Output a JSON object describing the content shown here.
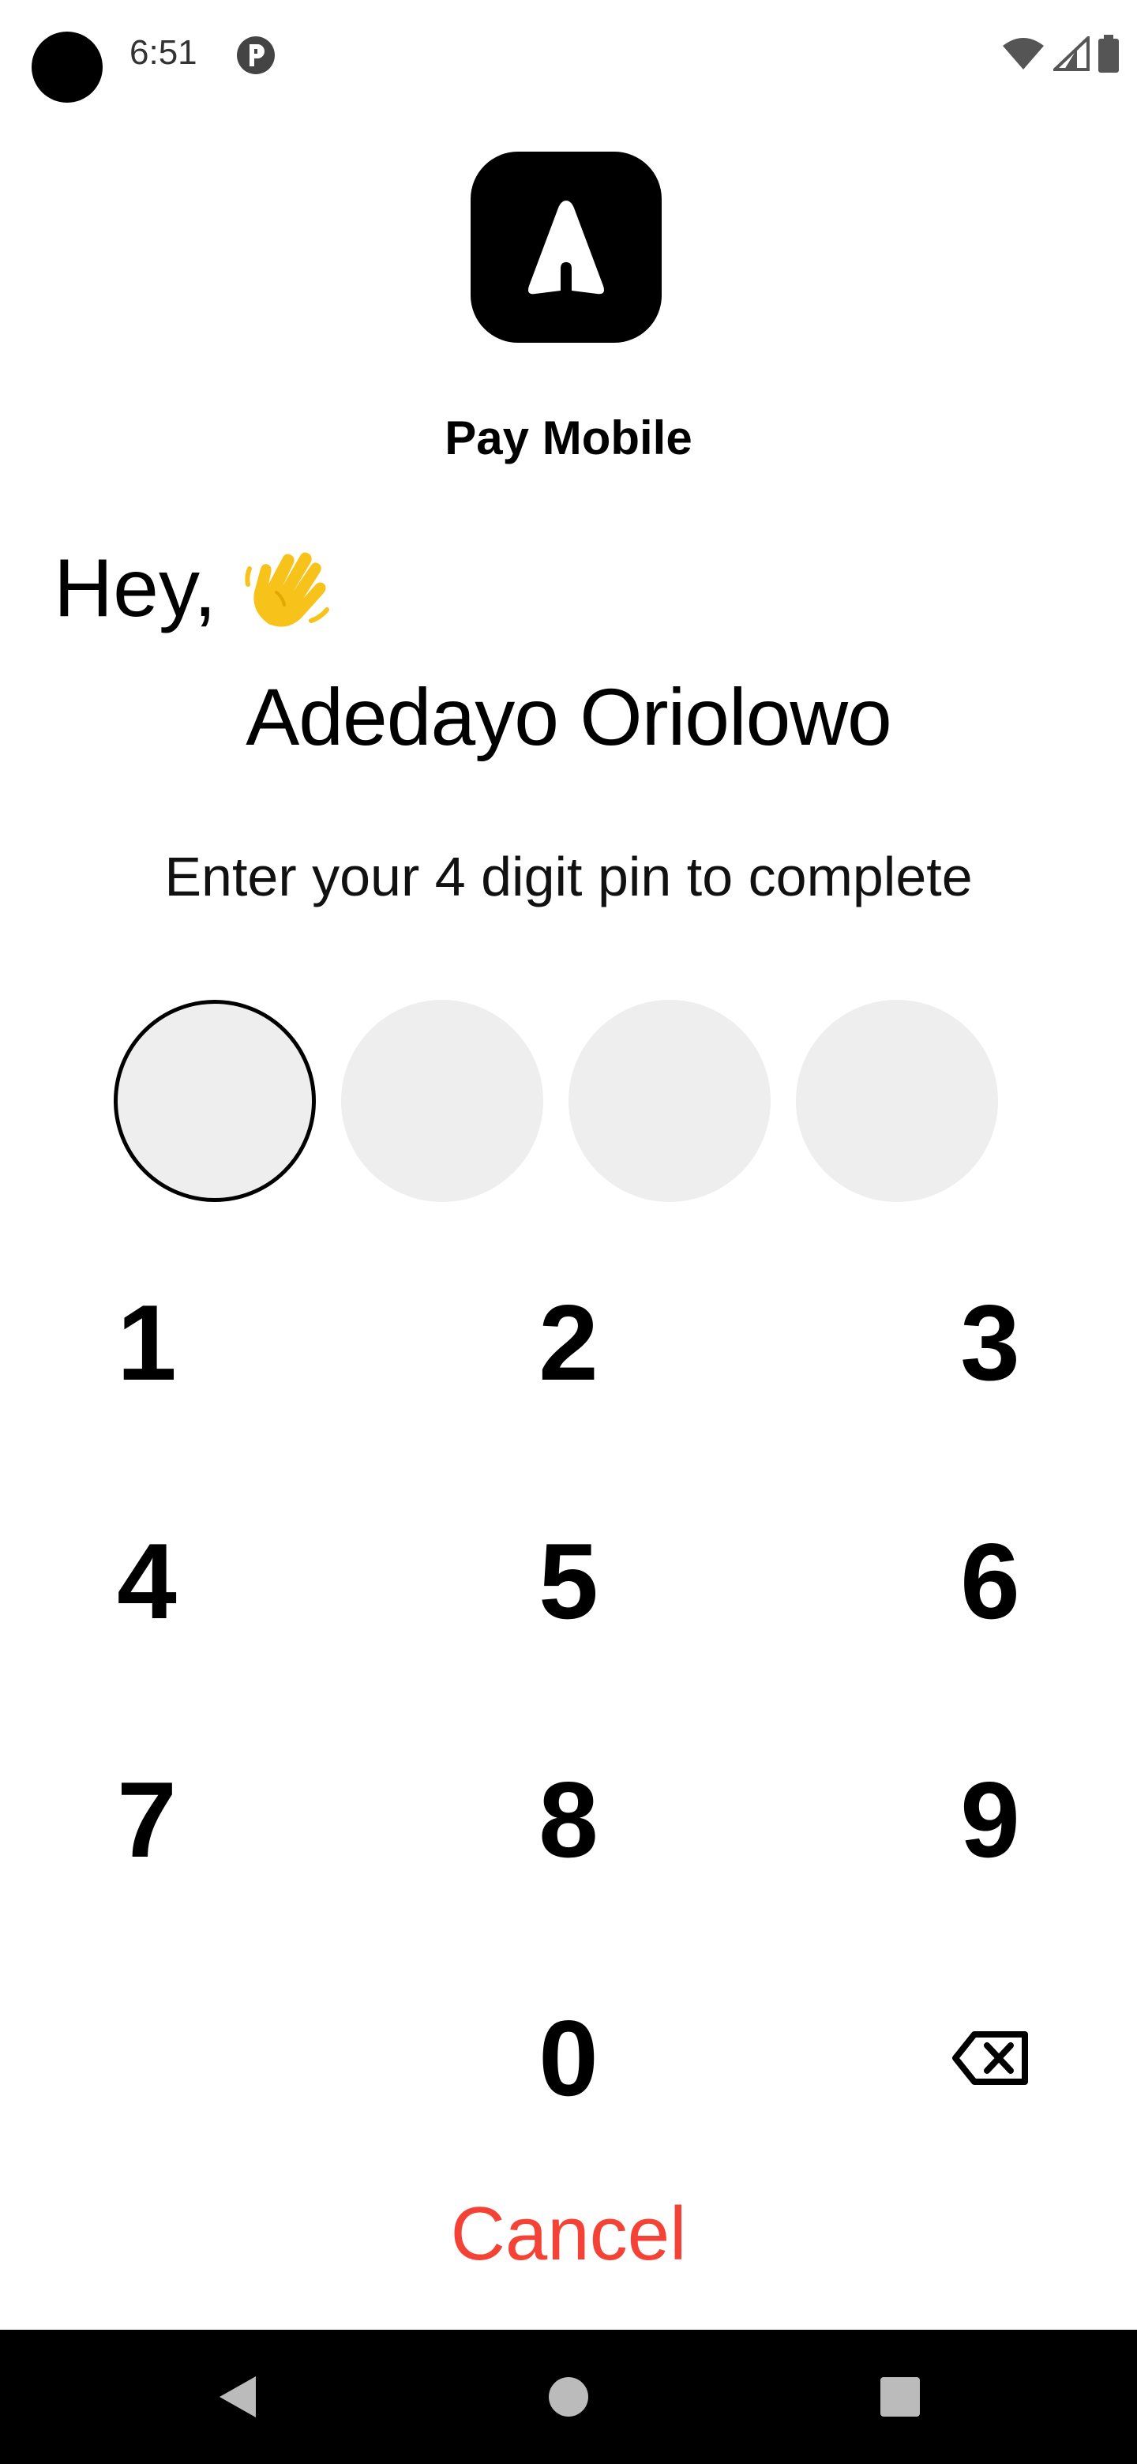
{
  "status_bar": {
    "time": "6:51",
    "icons": [
      "app-notification-icon",
      "wifi-icon",
      "cellular-signal-icon",
      "battery-icon"
    ]
  },
  "app": {
    "logo_icon": "paper-plane-logo-icon",
    "name": "Pay Mobile"
  },
  "greeting": {
    "text": "Hey,",
    "emoji_icon": "waving-hand-icon"
  },
  "user": {
    "name": "Adedayo Oriolowo"
  },
  "instruction": "Enter your 4 digit pin to complete",
  "pin": {
    "length": 4,
    "entered": 0,
    "active_index": 0
  },
  "keypad": {
    "keys": [
      "1",
      "2",
      "3",
      "4",
      "5",
      "6",
      "7",
      "8",
      "9",
      "0"
    ],
    "backspace_icon": "backspace-icon"
  },
  "cancel_label": "Cancel",
  "colors": {
    "cancel": "#f44336",
    "pin_fill": "#eeeeee",
    "emoji": "#f7c21a"
  },
  "nav_bar": {
    "icons": [
      "back-icon",
      "home-icon",
      "recents-icon"
    ]
  }
}
